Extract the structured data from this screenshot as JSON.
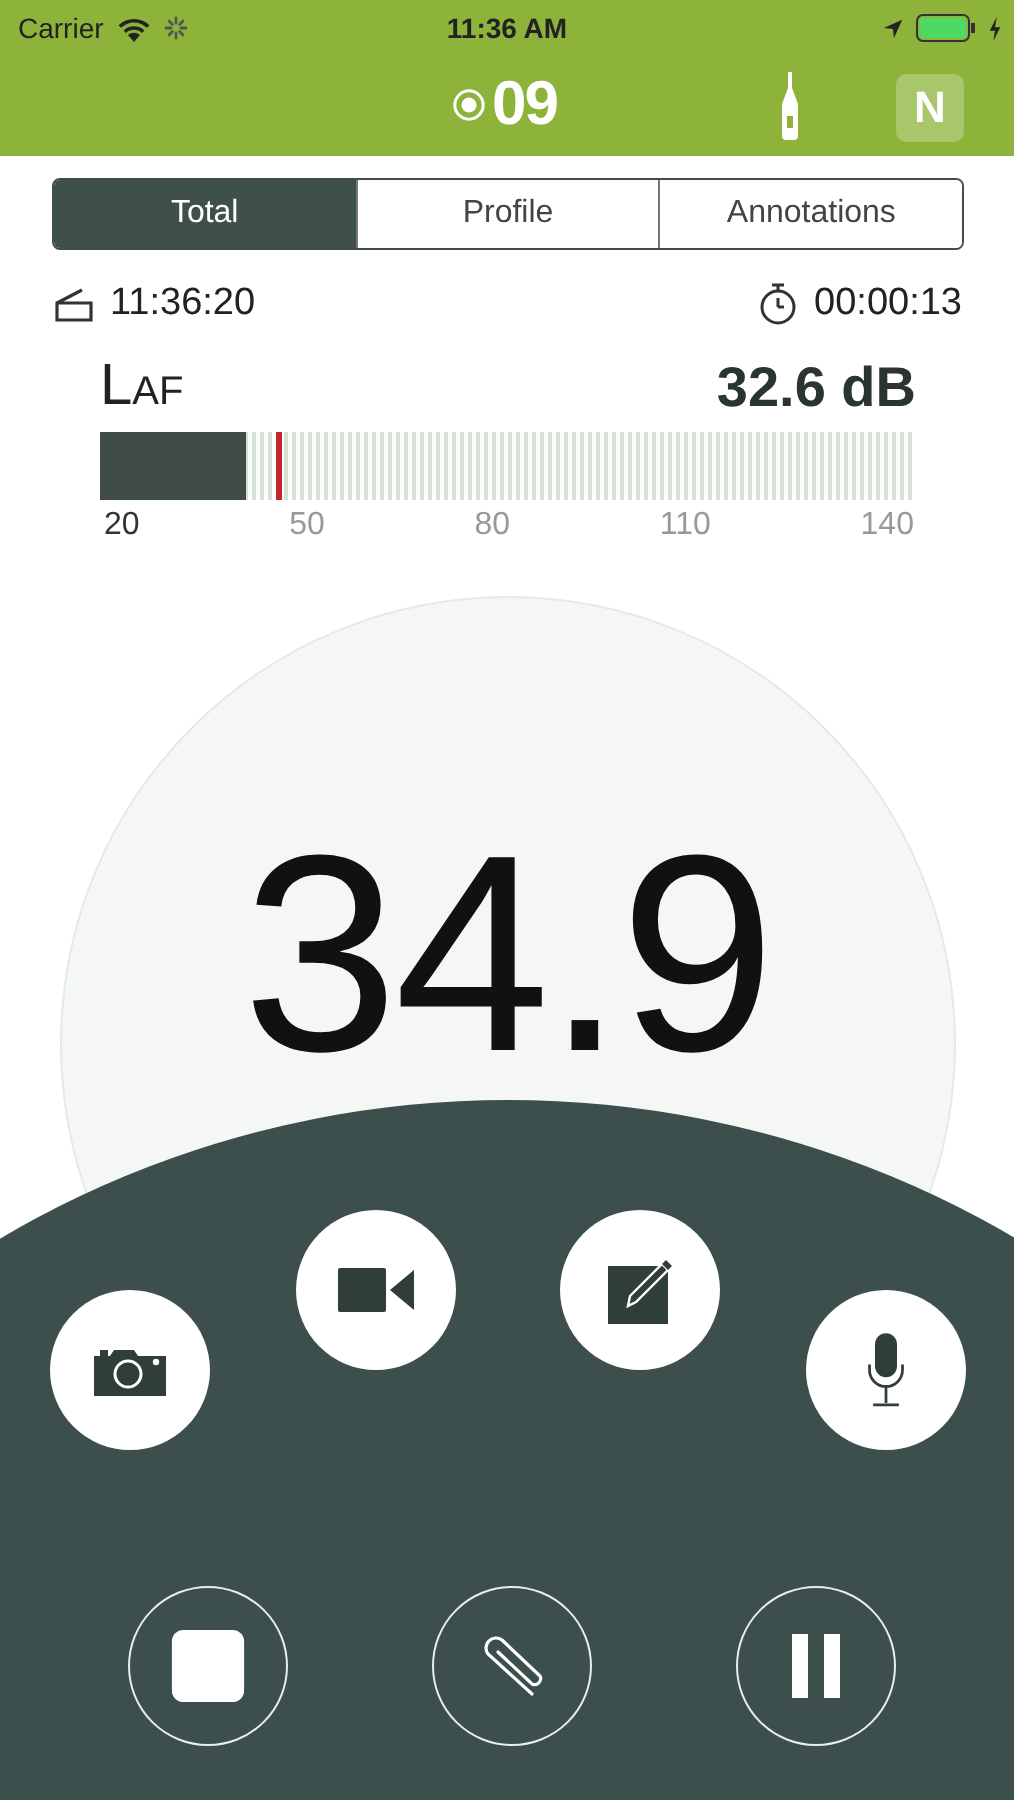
{
  "status_bar": {
    "carrier": "Carrier",
    "time": "11:36 AM"
  },
  "header": {
    "counter": "09",
    "badge": "N"
  },
  "tabs": [
    {
      "label": "Total",
      "selected": true
    },
    {
      "label": "Profile",
      "selected": false
    },
    {
      "label": "Annotations",
      "selected": false
    }
  ],
  "info": {
    "start_time": "11:36:20",
    "elapsed": "00:00:13"
  },
  "meter": {
    "label": "LAF",
    "reading": "32.6 dB",
    "level": 0.18,
    "peak": {
      "level": 0.215
    },
    "ticks": [
      {
        "label": "20",
        "active": true
      },
      {
        "label": "50",
        "active": false
      },
      {
        "label": "80",
        "active": false
      },
      {
        "label": "110",
        "active": false
      },
      {
        "label": "140",
        "active": false
      }
    ]
  },
  "main_value": "34.9",
  "actions": [
    {
      "kind": "camera"
    },
    {
      "kind": "video"
    },
    {
      "kind": "note"
    },
    {
      "kind": "microphone"
    }
  ],
  "controls": [
    {
      "kind": "stop"
    },
    {
      "kind": "attach"
    },
    {
      "kind": "pause"
    }
  ]
}
